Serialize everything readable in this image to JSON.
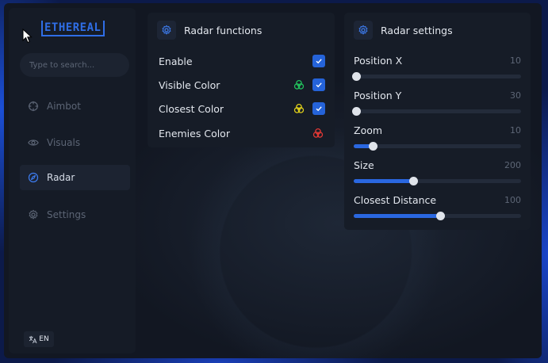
{
  "app": {
    "logo_text": "ETHEREAL",
    "brand_color": "#2f6ee6"
  },
  "search": {
    "placeholder": "Type to search..."
  },
  "sidebar": {
    "items": [
      {
        "label": "Aimbot",
        "icon": "crosshair-icon",
        "active": false
      },
      {
        "label": "Visuals",
        "icon": "eye-icon",
        "active": false
      },
      {
        "label": "Radar",
        "icon": "compass-icon",
        "active": true
      },
      {
        "label": "Settings",
        "icon": "gear-icon",
        "active": false
      }
    ],
    "language": "EN"
  },
  "radar_functions": {
    "title": "Radar functions",
    "rows": [
      {
        "label": "Enable",
        "checked": true,
        "color": null
      },
      {
        "label": "Visible Color",
        "checked": true,
        "color": "#22c55e"
      },
      {
        "label": "Closest Color",
        "checked": true,
        "color": "#e5d41a"
      },
      {
        "label": "Enemies Color",
        "checked": null,
        "color": "#e53935"
      }
    ]
  },
  "radar_settings": {
    "title": "Radar settings",
    "sliders": [
      {
        "label": "Position X",
        "value": "10",
        "fraction": 0.0
      },
      {
        "label": "Position Y",
        "value": "30",
        "fraction": 0.0
      },
      {
        "label": "Zoom",
        "value": "10",
        "fraction": 0.1
      },
      {
        "label": "Size",
        "value": "200",
        "fraction": 0.34
      },
      {
        "label": "Closest Distance",
        "value": "100",
        "fraction": 0.5
      }
    ]
  }
}
